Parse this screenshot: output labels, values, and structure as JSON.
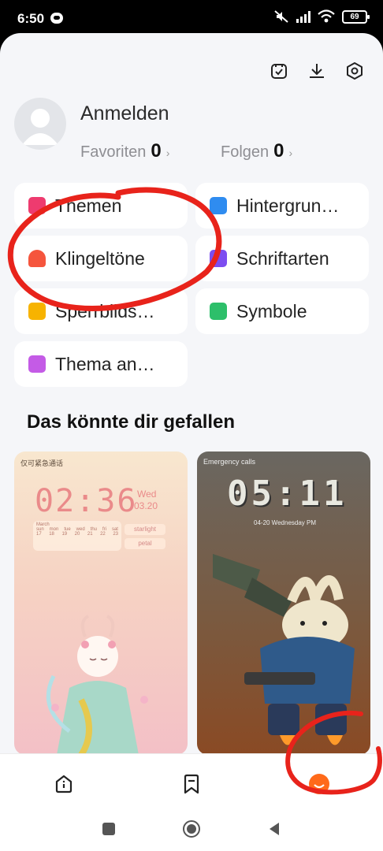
{
  "status": {
    "time": "6:50",
    "battery": "69"
  },
  "header": {
    "icons": [
      "coupon-icon",
      "download-icon",
      "settings-icon"
    ]
  },
  "profile": {
    "login_label": "Anmelden",
    "favorites_label": "Favoriten",
    "favorites_count": "0",
    "follow_label": "Folgen",
    "follow_count": "0",
    "chevron": "›"
  },
  "categories": [
    {
      "label": "Themen",
      "icon": "themes-icon",
      "color": "#ee3b6f"
    },
    {
      "label": "Hintergrun…",
      "icon": "wallpaper-icon",
      "color": "#2f8cf0"
    },
    {
      "label": "Klingeltöne",
      "icon": "ringtone-icon",
      "color": "#f5553d"
    },
    {
      "label": "Schriftarten",
      "icon": "fonts-icon",
      "color": "#7c4df0"
    },
    {
      "label": "Sperrbilds…",
      "icon": "lock-screen-icon",
      "color": "#f7b300"
    },
    {
      "label": "Symbole",
      "icon": "icons-icon",
      "color": "#2dbf6a"
    },
    {
      "label": "Thema an…",
      "icon": "customize-icon",
      "color": "#c45be6"
    }
  ],
  "recommend": {
    "title": "Das könnte dir gefallen",
    "cards": [
      {
        "status_text": "仅可紧急通话",
        "clock": "02:36",
        "day": "Wed",
        "date": "03.20",
        "month": "March",
        "weekdays": [
          "sun",
          "mon",
          "tue",
          "wed",
          "thu",
          "fri",
          "sat"
        ],
        "days": [
          "17",
          "18",
          "19",
          "20",
          "21",
          "22",
          "23"
        ],
        "tags": [
          "starlight",
          "petal"
        ]
      },
      {
        "status_text": "Emergency calls",
        "clock": "05:11",
        "date_line": "04-20 Wednesday PM"
      }
    ]
  },
  "tabs": [
    "home-tab-icon",
    "bookmark-tab-icon",
    "profile-tab-icon"
  ],
  "colors": {
    "accent": "#ff6a1a",
    "annotation": "#e8231b"
  }
}
